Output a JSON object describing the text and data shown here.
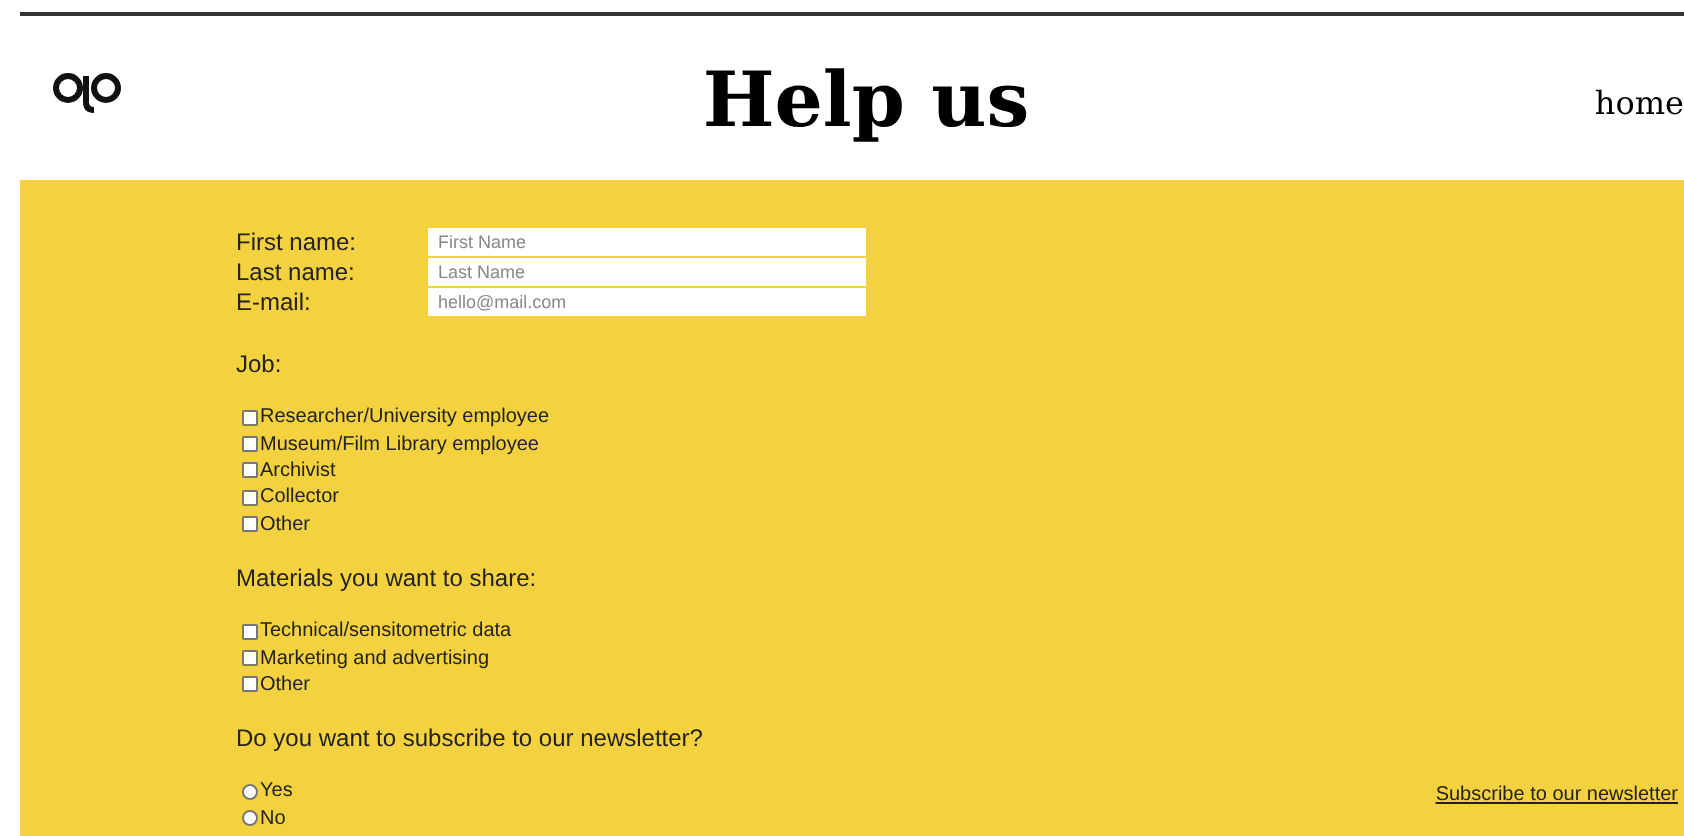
{
  "header": {
    "title": "Help us",
    "nav_link": "home"
  },
  "fields": [
    {
      "label": "First name:",
      "placeholder": "First Name"
    },
    {
      "label": "Last name:",
      "placeholder": "Last Name"
    },
    {
      "label": "E-mail:",
      "placeholder": "hello@mail.com"
    }
  ],
  "job": {
    "label": "Job:",
    "options": [
      {
        "label": "Researcher/University employee",
        "checked": false
      },
      {
        "label": "Museum/Film Library employee",
        "checked": false
      },
      {
        "label": "Archivist",
        "checked": false
      },
      {
        "label": "Collector",
        "checked": false
      },
      {
        "label": "Other",
        "checked": false
      }
    ]
  },
  "materials": {
    "label": "Materials you want to share:",
    "options": [
      {
        "label": "Technical/sensitometric data",
        "checked": false
      },
      {
        "label": "Marketing and advertising",
        "checked": false
      },
      {
        "label": "Other",
        "checked": false
      }
    ]
  },
  "newsletter": {
    "label": "Do you want to subscribe to our newsletter?",
    "options": [
      {
        "label": "Yes",
        "selected": false
      },
      {
        "label": "No",
        "selected": false
      }
    ]
  },
  "submit_link": "Subscribe to our newsletter"
}
